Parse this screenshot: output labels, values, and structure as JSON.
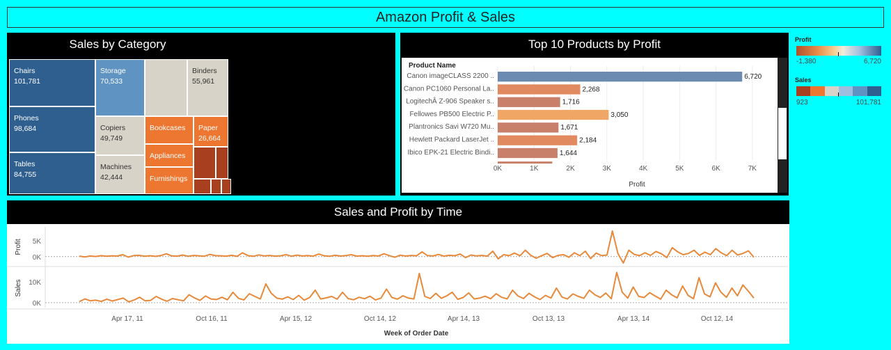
{
  "title": "Amazon Profit & Sales",
  "treemap": {
    "title": "Sales by Category",
    "cells": [
      {
        "name": "Chairs",
        "value": "101,781",
        "color": "#2e5f8f"
      },
      {
        "name": "Phones",
        "value": "98,684",
        "color": "#2e5f8f"
      },
      {
        "name": "Tables",
        "value": "84,755",
        "color": "#2e5f8f"
      },
      {
        "name": "Storage",
        "value": "70,533",
        "color": "#5f93c2"
      },
      {
        "name": "Binders",
        "value": "55,961",
        "color": "#d8d3c8"
      },
      {
        "name": "Copiers",
        "value": "49,749",
        "color": "#d8d3c8"
      },
      {
        "name": "Machines",
        "value": "42,444",
        "color": "#d8d3c8"
      },
      {
        "name": "Bookcases",
        "value": "",
        "color": "#ed7730"
      },
      {
        "name": "Appliances",
        "value": "",
        "color": "#ed7730"
      },
      {
        "name": "Furnishings",
        "value": "",
        "color": "#ed7730"
      },
      {
        "name": "Paper",
        "value": "26,664",
        "color": "#ed7730"
      }
    ]
  },
  "top10": {
    "title": "Top 10 Products by Profit",
    "row_header": "Product Name",
    "xlabel": "Profit"
  },
  "chart_data": [
    {
      "type": "bar",
      "title": "Top 10 Products by Profit",
      "xlabel": "Profit",
      "ylabel": "Product Name",
      "categories": [
        "Canon imageCLASS 2200 ..",
        "Canon PC1060 Personal La..",
        "LogitechÂ Z-906 Speaker s..",
        "Fellowes PB500 Electric P..",
        "Plantronics Savi W720 Mu..",
        "Hewlett Packard LaserJet ..",
        "Ibico EPK-21 Electric Bindi.."
      ],
      "values": [
        6720,
        2268,
        1716,
        3050,
        1671,
        2184,
        1644
      ],
      "value_labels": [
        "6,720",
        "2,268",
        "1,716",
        "3,050",
        "1,671",
        "2,184",
        "1,644"
      ],
      "colors": [
        "#6b8cb0",
        "#e28a5f",
        "#c9806a",
        "#f0a766",
        "#c9806a",
        "#e28a5f",
        "#c9806a"
      ],
      "xlim": [
        0,
        7500
      ],
      "xticks": [
        "0K",
        "1K",
        "2K",
        "3K",
        "4K",
        "5K",
        "6K",
        "7K"
      ]
    },
    {
      "type": "line",
      "title": "Sales and Profit by Time",
      "xlabel": "Week of Order Date",
      "xticks": [
        "Apr 17, 11",
        "Oct 16, 11",
        "Apr 15, 12",
        "Oct 14, 12",
        "Apr 14, 13",
        "Oct 13, 13",
        "Apr 13, 14",
        "Oct 12, 14"
      ],
      "series": [
        {
          "name": "Profit",
          "ylim": [
            -2000,
            8000
          ],
          "yticks": [
            "5K",
            "0K"
          ],
          "values": [
            150,
            -100,
            200,
            50,
            300,
            100,
            250,
            180,
            600,
            -150,
            320,
            400,
            120,
            280,
            80,
            350,
            900,
            220,
            150,
            500,
            100,
            380,
            260,
            140,
            700,
            300,
            250,
            150,
            420,
            90,
            1200,
            300,
            100,
            550,
            220,
            380,
            160,
            250,
            600,
            120,
            480,
            200,
            350,
            150,
            800,
            250,
            100,
            430,
            180,
            320,
            600,
            150,
            280,
            120,
            350,
            200,
            900,
            300,
            -200,
            450,
            170,
            380,
            250,
            1500,
            320,
            200,
            680,
            150,
            420,
            280,
            800,
            -300,
            500,
            220,
            380,
            160,
            1700,
            -700,
            600,
            300,
            1100,
            250,
            2000,
            400,
            -500,
            300,
            1000,
            -300,
            400,
            600,
            -200,
            1200,
            300,
            1700,
            -600,
            1100,
            300,
            500,
            8000,
            1000,
            -2500,
            2000,
            700,
            300,
            1200,
            400,
            1600,
            900,
            -300,
            2800,
            1500,
            600,
            1000,
            2000,
            400,
            1400,
            600,
            2500,
            1200,
            300,
            2000,
            500,
            1000,
            1800,
            -200
          ]
        },
        {
          "name": "Sales",
          "ylim": [
            -1000,
            15000
          ],
          "yticks": [
            "10K",
            "0K"
          ],
          "values": [
            500,
            1800,
            900,
            1200,
            600,
            1700,
            800,
            1500,
            2200,
            400,
            1300,
            2600,
            900,
            1100,
            3000,
            1700,
            700,
            2000,
            1400,
            900,
            3800,
            2300,
            1100,
            3200,
            1800,
            1500,
            2600,
            1400,
            5000,
            2100,
            1300,
            4300,
            3000,
            1800,
            9000,
            4500,
            2200,
            1700,
            2800,
            1500,
            3500,
            1200,
            2500,
            6000,
            1800,
            2300,
            3000,
            1700,
            5000,
            2000,
            1400,
            2600,
            1900,
            3100,
            1300,
            2200,
            6500,
            2500,
            1700,
            3300,
            2200,
            1800,
            14000,
            3000,
            2000,
            4500,
            2100,
            3300,
            5000,
            1600,
            2500,
            4700,
            1800,
            2200,
            3100,
            1900,
            4300,
            2600,
            1800,
            6000,
            3200,
            2000,
            4500,
            2800,
            1500,
            3500,
            2200,
            7000,
            2700,
            1800,
            4200,
            3000,
            2100,
            6000,
            3800,
            2500,
            4600,
            1900,
            14500,
            5000,
            2200,
            7500,
            3000,
            2500,
            4800,
            3200,
            1700,
            6000,
            3800,
            2300,
            8000,
            3500,
            1900,
            12000,
            4200,
            2800,
            9500,
            5000,
            2600,
            7000,
            3300,
            8500,
            5500,
            2200
          ]
        }
      ]
    }
  ],
  "timeline": {
    "title": "Sales and Profit by Time",
    "profit_axis": "Profit",
    "sales_axis": "Sales",
    "xlabel": "Week of Order Date"
  },
  "legend": {
    "profit_title": "Profit",
    "profit_min": "-1,380",
    "profit_max": "6,720",
    "sales_title": "Sales",
    "sales_min": "923",
    "sales_max": "101,781"
  }
}
